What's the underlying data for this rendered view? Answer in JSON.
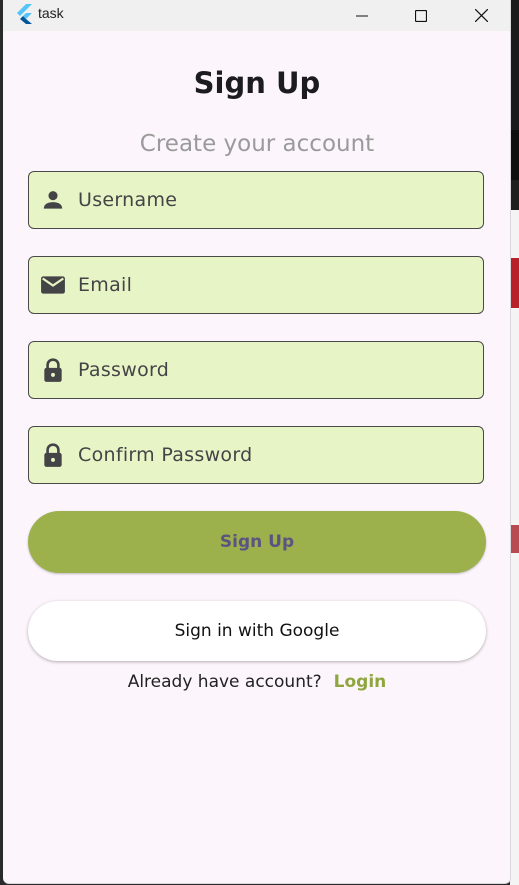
{
  "window": {
    "title": "task"
  },
  "page": {
    "title": "Sign Up",
    "subtitle": "Create your account"
  },
  "form": {
    "fields": [
      {
        "placeholder": "Username",
        "icon": "person-icon"
      },
      {
        "placeholder": "Email",
        "icon": "mail-icon"
      },
      {
        "placeholder": "Password",
        "icon": "lock-icon"
      },
      {
        "placeholder": "Confirm Password",
        "icon": "lock-icon"
      }
    ],
    "signup_label": "Sign Up",
    "google_label": "Sign in with Google",
    "login_prompt": "Already have account?",
    "login_link": "Login"
  },
  "colors": {
    "background": "#fdf5fc",
    "field_fill": "#e7f4c5",
    "primary_button": "#9cb14c",
    "primary_button_text": "#5b5480",
    "link": "#8fa63e"
  }
}
